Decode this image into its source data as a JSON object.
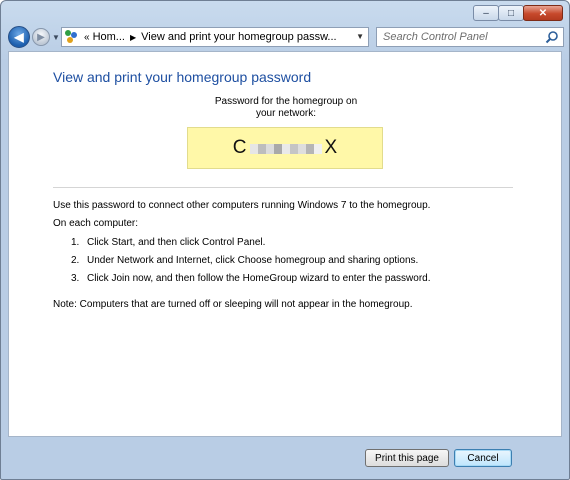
{
  "window": {
    "address_segments": [
      "Hom...",
      "View and print your homegroup passw..."
    ],
    "address_chevron": "«",
    "search_placeholder": "Search Control Panel",
    "caption_buttons": {
      "minimize": "–",
      "maximize": "□",
      "close": "✕"
    }
  },
  "page": {
    "title": "View and print your homegroup password",
    "password_label_line1": "Password for the homegroup on",
    "password_label_line2": "your network:",
    "password_first": "C",
    "password_last": "X",
    "intro": "Use this password to connect other computers running Windows 7 to the homegroup.",
    "on_each": "On each computer:",
    "steps": [
      {
        "num": "1.",
        "text": "Click Start, and then click Control Panel."
      },
      {
        "num": "2.",
        "text": "Under Network and Internet, click Choose homegroup and sharing options."
      },
      {
        "num": "3.",
        "text": "Click Join now, and then follow the HomeGroup wizard to enter the password."
      }
    ],
    "note": "Note: Computers that are turned off or sleeping will not appear in the homegroup."
  },
  "buttons": {
    "print": "Print this page",
    "cancel": "Cancel"
  },
  "colors": {
    "heading": "#1e4fa1",
    "password_box": "#fff8a8",
    "frame": "#b9cde5"
  }
}
